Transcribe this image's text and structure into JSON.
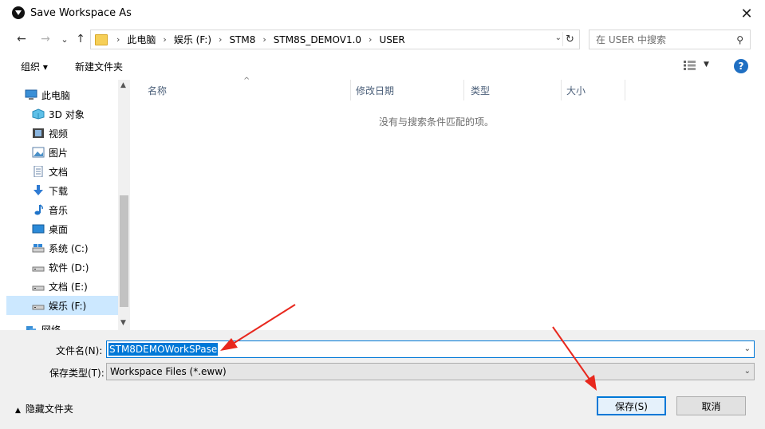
{
  "window": {
    "title": "Save Workspace As",
    "close_glyph": "✕"
  },
  "navigation": {
    "back_glyph": "←",
    "forward_glyph": "→",
    "recent_glyph": "⌄",
    "up_glyph": "↑",
    "breadcrumbs": [
      "此电脑",
      "娱乐 (F:)",
      "STM8",
      "STM8S_DEMOV1.0",
      "USER"
    ],
    "refresh_glyph": "↻",
    "search_placeholder": "在 USER 中搜索"
  },
  "toolbar": {
    "organize_label": "组织 ▾",
    "new_folder_label": "新建文件夹"
  },
  "sidebar": {
    "items": [
      {
        "label": "此电脑",
        "icon": "computer-icon"
      },
      {
        "label": "3D 对象",
        "icon": "3d-objects-icon"
      },
      {
        "label": "视频",
        "icon": "video-icon"
      },
      {
        "label": "图片",
        "icon": "pictures-icon"
      },
      {
        "label": "文档",
        "icon": "documents-icon"
      },
      {
        "label": "下载",
        "icon": "download-icon"
      },
      {
        "label": "音乐",
        "icon": "music-icon"
      },
      {
        "label": "桌面",
        "icon": "desktop-icon"
      },
      {
        "label": "系统 (C:)",
        "icon": "drive-icon"
      },
      {
        "label": "软件 (D:)",
        "icon": "drive-icon"
      },
      {
        "label": "文档 (E:)",
        "icon": "drive-icon"
      },
      {
        "label": "娱乐 (F:)",
        "icon": "drive-icon",
        "selected": true
      },
      {
        "label": "网络",
        "icon": "network-icon"
      }
    ]
  },
  "filelist": {
    "columns": [
      "名称",
      "修改日期",
      "类型",
      "大小"
    ],
    "empty_message": "没有与搜索条件匹配的项。"
  },
  "form": {
    "filename_label": "文件名(N):",
    "filename_value": "STM8DEMOWorkSPase",
    "filetype_label": "保存类型(T):",
    "filetype_value": "Workspace Files (*.eww)"
  },
  "footer": {
    "hide_folders_label": "隐藏文件夹",
    "save_label": "保存(S)",
    "cancel_label": "取消"
  },
  "colors": {
    "accent": "#0078d7",
    "annotation_arrow": "#e8281e",
    "selected_nav_bg": "#cce8ff"
  }
}
